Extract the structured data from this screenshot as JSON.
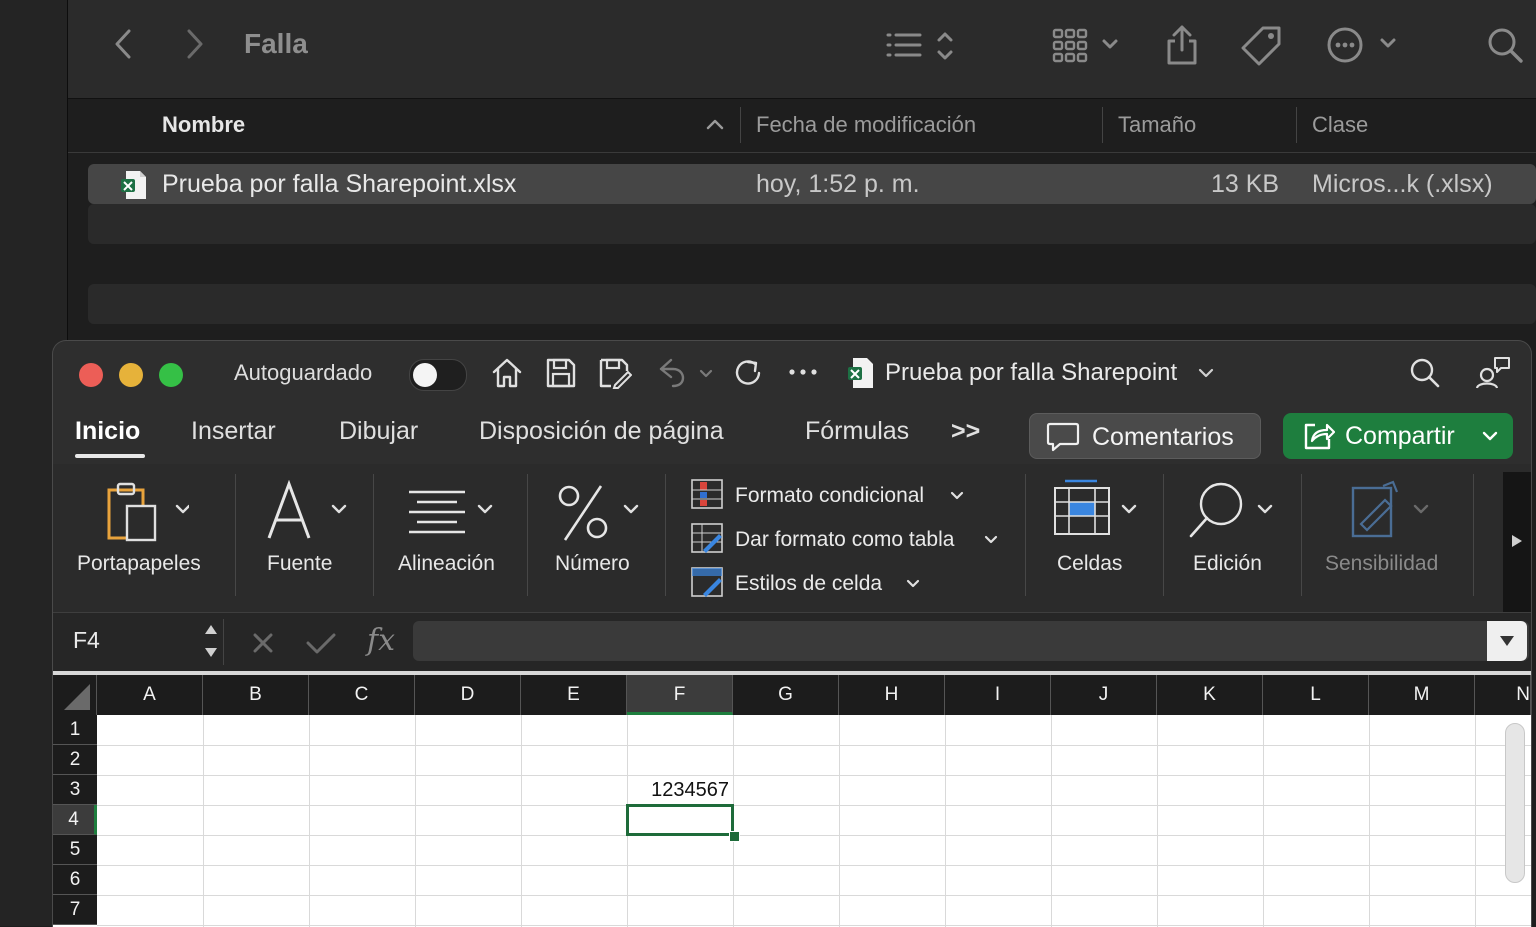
{
  "finder": {
    "title": "Falla",
    "columns": {
      "name": "Nombre",
      "modified": "Fecha de modificación",
      "size": "Tamaño",
      "kind": "Clase"
    },
    "file": {
      "name": "Prueba por falla Sharepoint.xlsx",
      "modified": "hoy, 1:52 p. m.",
      "size": "13 KB",
      "kind": "Micros...k (.xlsx)"
    }
  },
  "excel": {
    "autosave_label": "Autoguardado",
    "document_title": "Prueba por falla Sharepoint",
    "tabs": [
      "Inicio",
      "Insertar",
      "Dibujar",
      "Disposición de página",
      "Fórmulas"
    ],
    "active_tab": "Inicio",
    "more_tabs": ">>",
    "comments_button": "Comentarios",
    "share_button": "Compartir",
    "share_color": "#1e7e3e",
    "ribbon": {
      "clipboard": "Portapapeles",
      "font": "Fuente",
      "alignment": "Alineación",
      "number": "Número",
      "conditional_format": "Formato condicional",
      "format_as_table": "Dar formato como tabla",
      "cell_styles": "Estilos de celda",
      "cells": "Celdas",
      "editing": "Edición",
      "sensitivity": "Sensibilidad"
    },
    "name_box": "F4",
    "formula_value": "",
    "columns": [
      "A",
      "B",
      "C",
      "D",
      "E",
      "F",
      "G",
      "H",
      "I",
      "J",
      "K",
      "L",
      "M",
      "N"
    ],
    "rows": [
      "1",
      "2",
      "3",
      "4",
      "5",
      "6",
      "7"
    ],
    "selected_cell": "F4",
    "cells": {
      "F3": "1234567"
    }
  }
}
